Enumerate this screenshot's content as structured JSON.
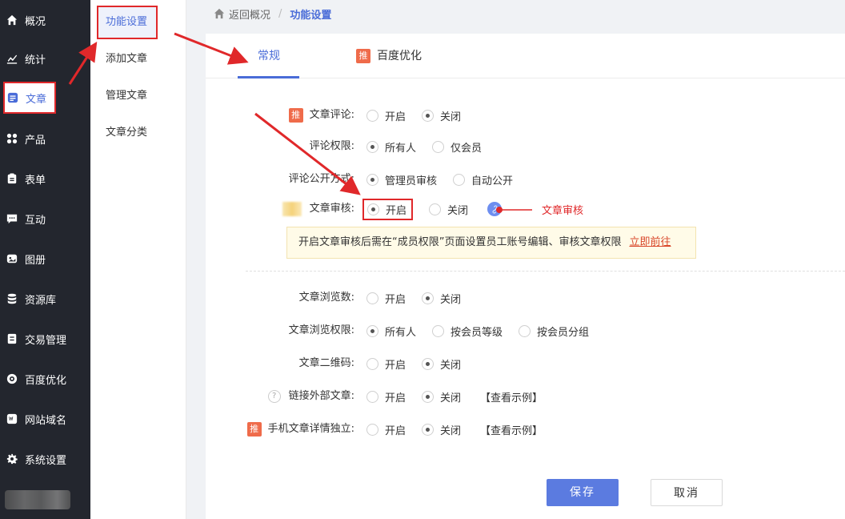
{
  "sidebar": {
    "items": [
      {
        "label": "概况",
        "icon": "home-icon"
      },
      {
        "label": "统计",
        "icon": "chart-icon"
      },
      {
        "label": "文章",
        "icon": "article-icon"
      },
      {
        "label": "产品",
        "icon": "grid-icon"
      },
      {
        "label": "表单",
        "icon": "form-icon"
      },
      {
        "label": "互动",
        "icon": "chat-icon"
      },
      {
        "label": "图册",
        "icon": "gallery-icon"
      },
      {
        "label": "资源库",
        "icon": "database-icon"
      },
      {
        "label": "交易管理",
        "icon": "order-icon"
      },
      {
        "label": "百度优化",
        "icon": "baidu-icon"
      },
      {
        "label": "网站域名",
        "icon": "domain-icon"
      },
      {
        "label": "系统设置",
        "icon": "gear-icon"
      }
    ]
  },
  "submenu": {
    "items": [
      "功能设置",
      "添加文章",
      "管理文章",
      "文章分类"
    ]
  },
  "breadcrumb": {
    "back": "返回概况",
    "sep": "/",
    "current": "功能设置"
  },
  "tabs": {
    "normal": "常规",
    "baidu_badge": "推",
    "baidu": "百度优化"
  },
  "form": {
    "comment": {
      "badge": "推",
      "label": "文章评论:",
      "opt1": "开启",
      "opt2": "关闭"
    },
    "comment_perm": {
      "label": "评论权限:",
      "opt1": "所有人",
      "opt2": "仅会员"
    },
    "comment_public": {
      "label": "评论公开方式:",
      "opt1": "管理员审核",
      "opt2": "自动公开"
    },
    "review": {
      "label": "文章审核:",
      "opt1": "开启",
      "opt2": "关闭"
    },
    "notice": {
      "text": "开启文章审核后需在“成员权限”页面设置员工账号编辑、审核文章权限",
      "link": "立即前往"
    },
    "views": {
      "label": "文章浏览数:",
      "opt1": "开启",
      "opt2": "关闭"
    },
    "view_perm": {
      "label": "文章浏览权限:",
      "opt1": "所有人",
      "opt2": "按会员等级",
      "opt3": "按会员分组"
    },
    "qrcode": {
      "label": "文章二维码:",
      "opt1": "开启",
      "opt2": "关闭"
    },
    "external": {
      "q": "?",
      "label": "链接外部文章:",
      "opt1": "开启",
      "opt2": "关闭",
      "sample": "【查看示例】"
    },
    "mobile": {
      "badge": "推",
      "label": "手机文章详情独立:",
      "opt1": "开启",
      "opt2": "关闭",
      "sample": "【查看示例】"
    }
  },
  "annotation": {
    "text": "文章审核",
    "color": "#e0282a"
  },
  "buttons": {
    "save": "保存",
    "cancel": "取消"
  },
  "colors": {
    "accent": "#4a6cd8",
    "sidebar_bg": "#23262e",
    "highlight": "#e0282a"
  }
}
